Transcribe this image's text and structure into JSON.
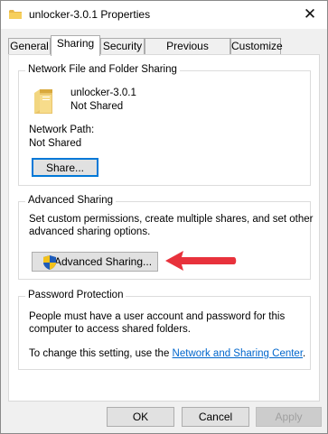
{
  "window": {
    "title": "unlocker-3.0.1 Properties",
    "close_symbol": "✕",
    "title_icon": "folder-icon"
  },
  "tabs": [
    {
      "label": "General"
    },
    {
      "label": "Sharing"
    },
    {
      "label": "Security"
    },
    {
      "label": "Previous Versions"
    },
    {
      "label": "Customize"
    }
  ],
  "active_tab": "Sharing",
  "network_sharing": {
    "group_title": "Network File and Folder Sharing",
    "folder_name": "unlocker-3.0.1",
    "folder_status": "Not Shared",
    "network_path_label": "Network Path:",
    "network_path_value": "Not Shared",
    "share_button": "Share..."
  },
  "advanced_sharing": {
    "group_title": "Advanced Sharing",
    "description_line1": "Set custom permissions, create multiple shares, and set other",
    "description_line2": "advanced sharing options.",
    "button_label": "Advanced Sharing..."
  },
  "password_protection": {
    "group_title": "Password Protection",
    "line1": "People must have a user account and password for this",
    "line2": "computer to access shared folders.",
    "change_prefix": "To change this setting, use the ",
    "link_text": "Network and Sharing Center",
    "change_suffix": "."
  },
  "footer": {
    "ok": "OK",
    "cancel": "Cancel",
    "apply": "Apply"
  },
  "colors": {
    "arrow": "#e8323c",
    "link": "#0066cc",
    "focus": "#0078d7"
  }
}
